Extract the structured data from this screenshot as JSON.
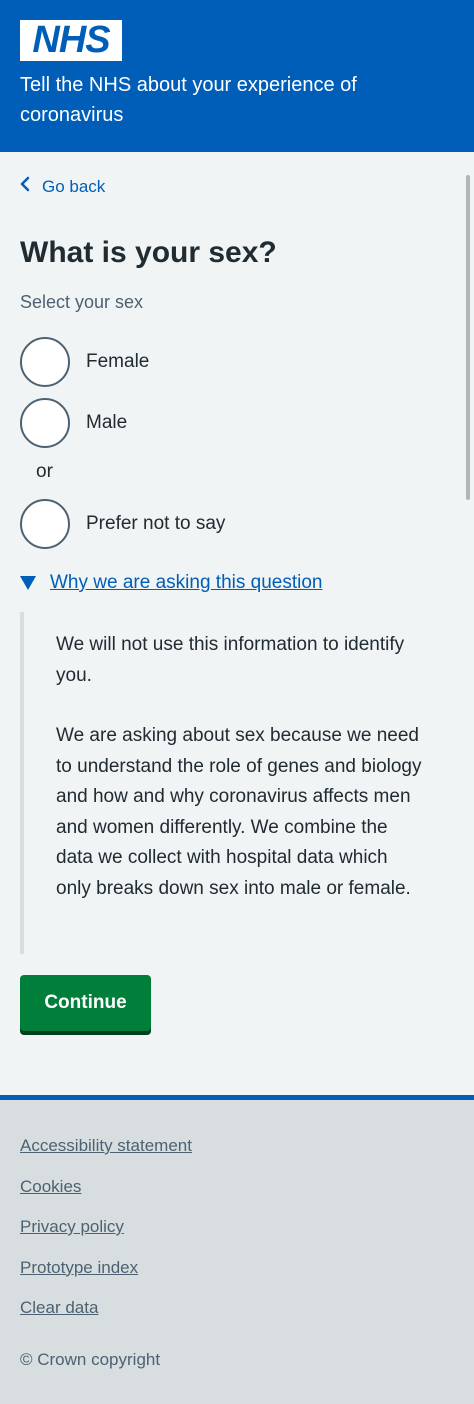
{
  "header": {
    "logo_text": "NHS",
    "service_name": "Tell the NHS about your experience of coronavirus"
  },
  "back_link": {
    "label": "Go back"
  },
  "question": {
    "title": "What is your sex?",
    "hint": "Select your sex",
    "options": [
      {
        "label": "Female"
      },
      {
        "label": "Male"
      },
      {
        "label": "Prefer not to say"
      }
    ],
    "divider": "or"
  },
  "details": {
    "summary": "Why we are asking this question",
    "paragraphs": [
      "We will not use this information to identify you.",
      "We are asking about sex because we need to understand the role of genes and biology and how and why coronavirus affects men and women differently. We combine the data we collect with hospital data which only breaks down sex into male or female."
    ]
  },
  "continue_label": "Continue",
  "footer": {
    "links": [
      "Accessibility statement",
      "Cookies",
      "Privacy policy",
      "Prototype index",
      "Clear data"
    ],
    "copyright": "© Crown copyright"
  },
  "colors": {
    "nhs_blue": "#005eb8",
    "button_green": "#007f3b",
    "background": "#f0f4f5",
    "footer_background": "#d8dde0"
  }
}
